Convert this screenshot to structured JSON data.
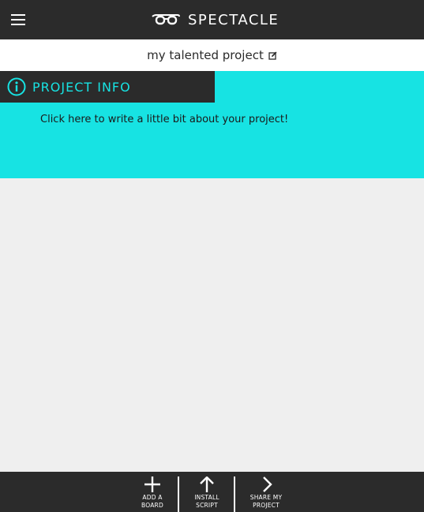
{
  "header": {
    "brand_name": "SPECTACLE",
    "menu_icon": "hamburger-icon",
    "logo_icon": "glasses-icon"
  },
  "project": {
    "title": "my talented project",
    "edit_icon": "edit-icon"
  },
  "info": {
    "heading": "PROJECT INFO",
    "icon": "info-icon",
    "text": "Click here to write a little bit about your project!"
  },
  "toolbar": {
    "add_board_line1": "ADD A",
    "add_board_line2": "BOARD",
    "install_line1": "INSTALL",
    "install_line2": "SCRIPT",
    "share_line1": "SHARE MY",
    "share_line2": "PROJECT"
  },
  "colors": {
    "dark": "#2b2b2b",
    "accent": "#17e3e3",
    "background": "#efefef"
  }
}
